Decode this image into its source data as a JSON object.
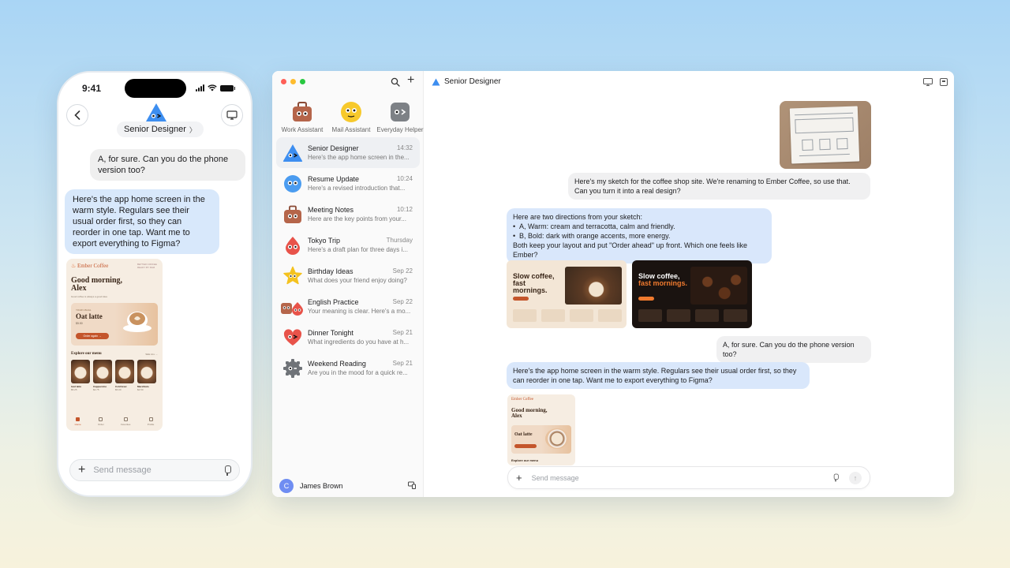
{
  "phone": {
    "status_time": "9:41",
    "agent_name": "Senior Designer",
    "messages": [
      {
        "role": "user",
        "text": "A, for sure. Can you do the phone version too?"
      },
      {
        "role": "assistant",
        "text": "Here's the app home screen in the warm style. Regulars see their usual order first, so they can reorder in one tap. Want me to export everything to Figma?"
      }
    ],
    "preview": {
      "brand": "Ember Coffee",
      "tagline": "BETTER COFFEE READY BY 8AM",
      "greeting": "Good morning, Alex",
      "subtext": "Good coffee is always a good idea",
      "card_kicker": "YOUR USUAL",
      "card_title": "Oat latte",
      "card_price": "$5.50",
      "card_button": "Order again →",
      "menu_title": "Explore our menu",
      "see_all": "SEE ALL →",
      "menu_items": [
        {
          "name": "Iced latte",
          "price": "$5.25"
        },
        {
          "name": "Cappuccino",
          "price": "$4.75"
        },
        {
          "name": "Cold brew",
          "price": "$5.00"
        },
        {
          "name": "Macchiato",
          "price": "$4.50"
        }
      ],
      "nav": [
        "Home",
        "Order",
        "Favorites",
        "Profile"
      ]
    },
    "composer_placeholder": "Send message"
  },
  "window": {
    "pinned_agents": [
      {
        "label": "Work Assistant",
        "icon": "briefcase-face-icon",
        "color": "#b5654a"
      },
      {
        "label": "Mail Assistant",
        "icon": "yellow-face-icon",
        "color": "#f7c92c"
      },
      {
        "label": "Everyday Helper",
        "icon": "gray-face-icon",
        "color": "#7d8186"
      }
    ],
    "chats": [
      {
        "name": "Senior Designer",
        "time": "14:32",
        "preview": "Here's the app home screen in the...",
        "icon": "blue-triangle-face-icon",
        "color": "#3d8ef0",
        "active": true
      },
      {
        "name": "Resume Update",
        "time": "10:24",
        "preview": "Here's a revised introduction that...",
        "icon": "blue-circle-face-icon",
        "color": "#4b9cf0",
        "active": false
      },
      {
        "name": "Meeting Notes",
        "time": "10:12",
        "preview": "Here are the key points from your...",
        "icon": "briefcase-face-icon",
        "color": "#b5654a",
        "active": false
      },
      {
        "name": "Tokyo Trip",
        "time": "Thursday",
        "preview": "Here's a draft plan for three days i...",
        "icon": "red-drop-face-icon",
        "color": "#e8534a",
        "active": false
      },
      {
        "name": "Birthday Ideas",
        "time": "Sep 22",
        "preview": "What does your friend enjoy doing?",
        "icon": "yellow-star-face-icon",
        "color": "#f4c21f",
        "active": false
      },
      {
        "name": "English Practice",
        "time": "Sep 22",
        "preview": "Your meaning is clear. Here's a mo...",
        "icon": "pair-face-icon",
        "color": "#e06040",
        "active": false
      },
      {
        "name": "Dinner Tonight",
        "time": "Sep 21",
        "preview": "What ingredients do you have at h...",
        "icon": "red-heart-face-icon",
        "color": "#e8534a",
        "active": false
      },
      {
        "name": "Weekend Reading",
        "time": "Sep 21",
        "preview": "Are you in the mood for a quick re...",
        "icon": "gear-face-icon",
        "color": "#6f7378",
        "active": false
      }
    ],
    "user": {
      "initial": "C",
      "name": "James Brown"
    },
    "title": "Senior Designer",
    "messages": {
      "m1": "Here's my sketch for the coffee shop site. We're renaming to Ember Coffee, so use that. Can you turn it into a real design?",
      "m2_intro": "Here are two directions from your sketch:",
      "m2_a": "A, Warm: cream and terracotta, calm and friendly.",
      "m2_b": "B, Bold: dark with orange accents, more energy.",
      "m2_outro": "Both keep your layout and put \"Order ahead\" up front. Which one feels like Ember?",
      "m3": "A, for sure. Can you do the phone version too?",
      "m4": "Here's the app home screen in the warm style. Regulars see their usual order first, so they can reorder in one tap. Want me to export everything to Figma?"
    },
    "designs": {
      "warm_headline": "Slow coffee, fast mornings.",
      "bold_line1": "Slow coffee,",
      "bold_line2": "fast mornings."
    },
    "mini_preview": {
      "brand": "Ember Coffee",
      "greeting": "Good morning, Alex",
      "card_title": "Oat latte",
      "menu_title": "Explore our menu"
    },
    "composer_placeholder": "Send message"
  }
}
